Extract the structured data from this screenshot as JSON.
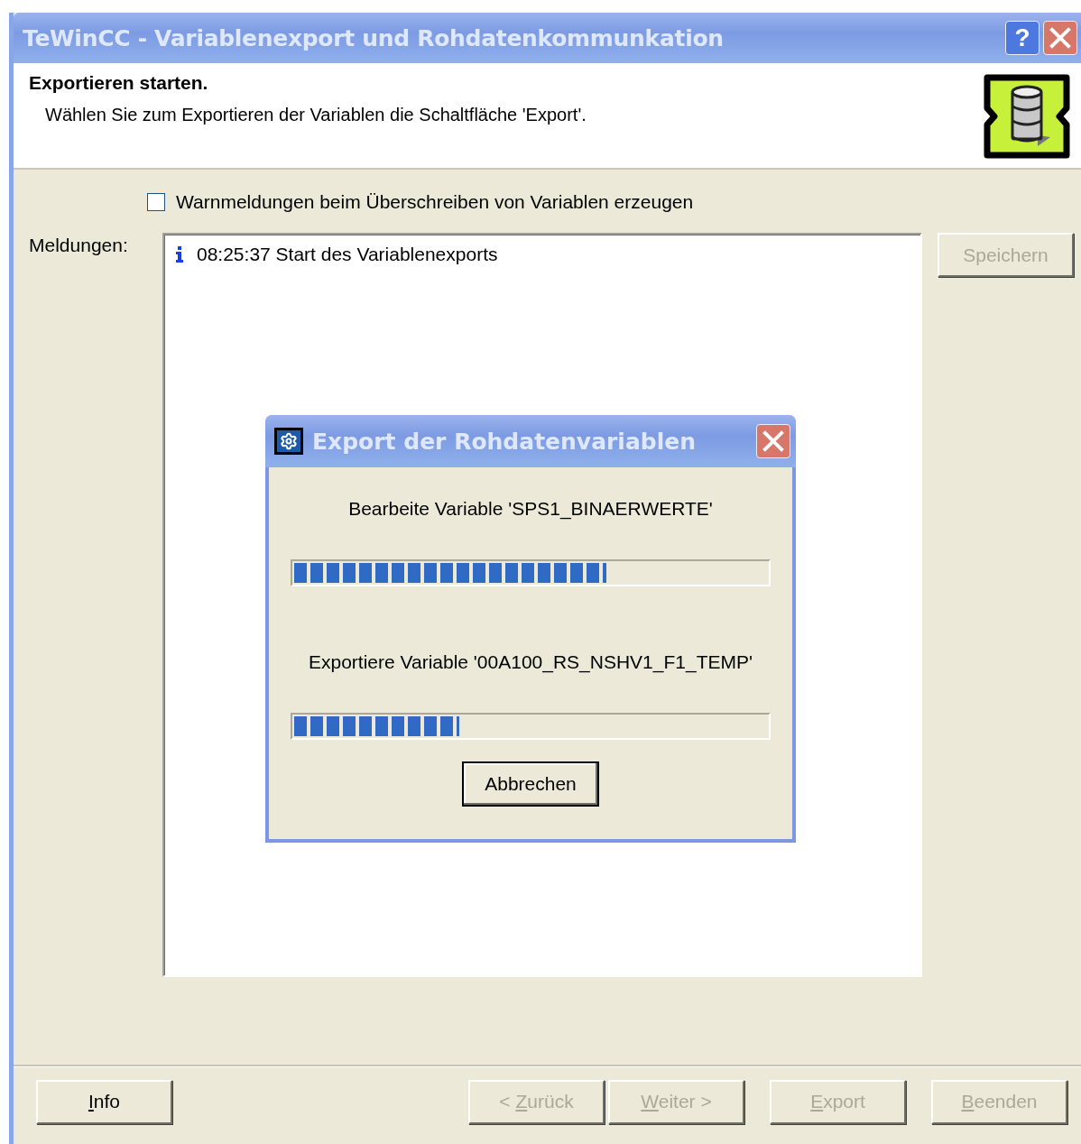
{
  "window": {
    "title": "TeWinCC - Variablenexport und Rohdatenkommunkation",
    "help_button": "?"
  },
  "header": {
    "title": "Exportieren starten.",
    "subtitle": "Wählen Sie zum Exportieren der Variablen die Schaltfläche 'Export'."
  },
  "warning_checkbox": {
    "label": "Warnmeldungen beim Überschreiben von Variablen erzeugen",
    "checked": false
  },
  "messages": {
    "label": "Meldungen:",
    "entries": [
      {
        "kind": "info",
        "text": "08:25:37 Start des Variablenexports"
      }
    ]
  },
  "save_button": {
    "label": "Speichern",
    "disabled": true
  },
  "footer_buttons": [
    {
      "key": "I",
      "post": "nfo",
      "disabled": false
    },
    {
      "pre": "< ",
      "key": "Z",
      "post": "urück",
      "disabled": true
    },
    {
      "key": "W",
      "post": "eiter >",
      "disabled": true
    },
    {
      "key": "E",
      "post": "xport",
      "disabled": true
    },
    {
      "key": "B",
      "post": "eenden",
      "disabled": true
    }
  ],
  "dialog": {
    "title": "Export der Rohdatenvariablen",
    "steps": [
      {
        "text": "Bearbeite Variable 'SPS1_BINAERWERTE'",
        "level": 0.66
      },
      {
        "text": "Exportiere Variable '00A100_RS_NSHV1_F1_TEMP'",
        "level": 0.345
      }
    ],
    "cancel_button": "Abbrechen"
  }
}
